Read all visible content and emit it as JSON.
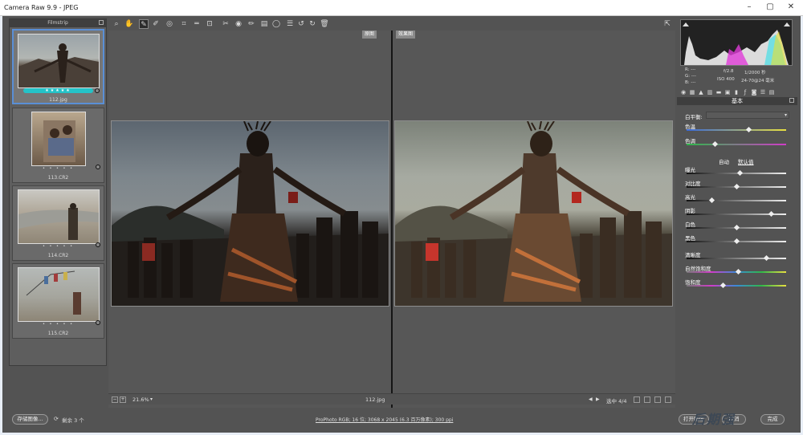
{
  "window": {
    "title": "Camera Raw 9.9 -  JPEG"
  },
  "filmstrip": {
    "header": "Filmstrip",
    "items": [
      {
        "name": "112.jpg",
        "stars": "★★★★★",
        "selected": true
      },
      {
        "name": "113.CR2",
        "stars": "• • • • •"
      },
      {
        "name": "114.CR2",
        "stars": "• • • • •"
      },
      {
        "name": "115.CR2",
        "stars": "• • • • •"
      }
    ]
  },
  "toolbar": {
    "tools": [
      "zoom-icon",
      "hand-icon",
      "white-balance-icon",
      "color-sampler-icon",
      "targeted-adjustment-icon",
      "crop-icon",
      "straighten-icon",
      "transform-icon",
      "spot-removal-icon",
      "red-eye-icon",
      "adjustment-brush-icon",
      "graduated-filter-icon",
      "radial-filter-icon",
      "preferences-icon",
      "rotate-left-icon",
      "rotate-right-icon",
      "trash-icon"
    ],
    "active": "white-balance-icon"
  },
  "preview": {
    "before_label": "原图",
    "after_label": "效果图",
    "zoom": "21.6%",
    "filename": "112.jpg",
    "selection": "选中 4/4"
  },
  "histogram": {
    "readout": {
      "r": "R: ---",
      "g": "G: ---",
      "b": "B: ---",
      "aperture": "f/2.8",
      "shutter": "1/2000 秒",
      "iso": "ISO 400",
      "lens": "24-70@24 毫米"
    }
  },
  "basic_panel": {
    "title": "基本",
    "white_balance_label": "白平衡:",
    "auto": "自动",
    "default": "默认值",
    "sliders": [
      {
        "label": "色温",
        "value": 0.62
      },
      {
        "label": "色调",
        "value": 0.28
      },
      {
        "label": "曝光",
        "value": 0.53
      },
      {
        "label": "对比度",
        "value": 0.5
      },
      {
        "label": "高光",
        "value": 0.25
      },
      {
        "label": "阴影",
        "value": 0.85
      },
      {
        "label": "白色",
        "value": 0.5
      },
      {
        "label": "黑色",
        "value": 0.5
      },
      {
        "label": "清晰度",
        "value": 0.8
      },
      {
        "label": "自然饱和度",
        "value": 0.52
      },
      {
        "label": "饱和度",
        "value": 0.36
      }
    ]
  },
  "bottombar": {
    "save": "存储图像...",
    "remaining": "剩余 3 个",
    "workflow": "ProPhoto RGB; 16 位; 3068 x 2045 (6.3 百万像素); 300 ppi",
    "open": "打开图像",
    "cancel": "取消",
    "done": "完成"
  },
  "watermark": "后期强",
  "colors": {
    "accent": "#5a8fd6",
    "rating": "#24c3c8"
  }
}
